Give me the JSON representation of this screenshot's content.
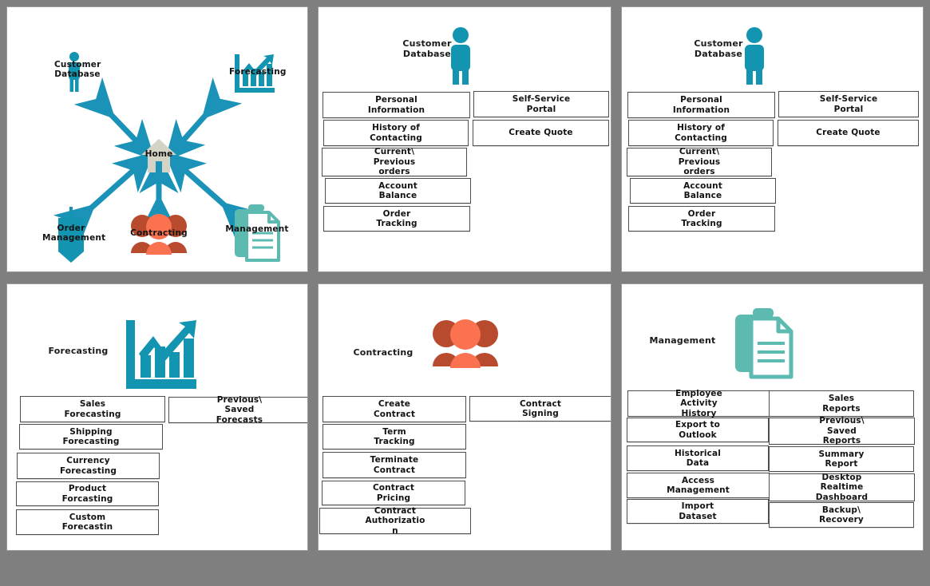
{
  "document": {
    "kind": "wireframe-storyboard",
    "rows": 2,
    "columns": 3,
    "background_color": "#7f7f7f",
    "panel_background": "#ffffff"
  },
  "colors": {
    "teal_blue": "#1394b0",
    "teal_green": "#5dbab0",
    "orange_front": "#fa7250",
    "orange_back": "#b84a2e",
    "home_gray": "#d5d2c6",
    "arrow_blue": "#1b93b8",
    "box_border": "#4d4d4d",
    "text": "#131313",
    "frame_gray": "#7f7f7f"
  },
  "panels": [
    {
      "id": "navigation-map",
      "type": "map",
      "center_node": {
        "label": "Home",
        "icon": "home-icon"
      },
      "nodes": [
        {
          "label": "Customer\nDatabase",
          "label_line1": "Customer",
          "label_line2": "Database",
          "icon": "person-icon",
          "position": "top-left"
        },
        {
          "label": "Forecasting",
          "label_line1": "Forecasting",
          "label_line2": "",
          "icon": "bar-chart-arrow-icon",
          "position": "top-right"
        },
        {
          "label": "Order\nManagement",
          "label_line1": "Order",
          "label_line2": "Management",
          "icon": "tag-icon",
          "position": "bottom-left"
        },
        {
          "label": "Contracting",
          "label_line1": "Contracting",
          "label_line2": "",
          "icon": "people-group-icon",
          "position": "bottom-center"
        },
        {
          "label": "Management",
          "label_line1": "Management",
          "label_line2": "",
          "icon": "clipboard-document-icon",
          "position": "bottom-right"
        }
      ],
      "connectors": [
        {
          "from": "Home",
          "to": "Customer Database",
          "style": "double-arrow"
        },
        {
          "from": "Home",
          "to": "Forecasting",
          "style": "double-arrow"
        },
        {
          "from": "Home",
          "to": "Order Management",
          "style": "double-arrow"
        },
        {
          "from": "Home",
          "to": "Contracting",
          "style": "double-arrow"
        },
        {
          "from": "Home",
          "to": "Management",
          "style": "double-arrow"
        }
      ]
    },
    {
      "id": "customer-database-a",
      "type": "screen",
      "title_line1": "Customer",
      "title_line2": "Database",
      "icon": "person-icon",
      "left_items": [
        {
          "line1": "Personal",
          "line2": "Information",
          "line3": ""
        },
        {
          "line1": "History of",
          "line2": "Contacting",
          "line3": ""
        },
        {
          "line1": "Current\\",
          "line2": "Previous",
          "line3": "orders"
        },
        {
          "line1": "Account",
          "line2": "Balance",
          "line3": ""
        },
        {
          "line1": "Order",
          "line2": "Tracking",
          "line3": ""
        }
      ],
      "right_items": [
        {
          "line1": "Self-Service",
          "line2": "Portal",
          "line3": ""
        },
        {
          "line1": "Create Quote",
          "line2": "",
          "line3": ""
        }
      ]
    },
    {
      "id": "customer-database-b",
      "type": "screen",
      "title_line1": "Customer",
      "title_line2": "Database",
      "icon": "person-icon",
      "left_items": [
        {
          "line1": "Personal",
          "line2": "Information",
          "line3": ""
        },
        {
          "line1": "History of",
          "line2": "Contacting",
          "line3": ""
        },
        {
          "line1": "Current\\",
          "line2": "Previous",
          "line3": "orders"
        },
        {
          "line1": "Account",
          "line2": "Balance",
          "line3": ""
        },
        {
          "line1": "Order",
          "line2": "Tracking",
          "line3": ""
        }
      ],
      "right_items": [
        {
          "line1": "Self-Service",
          "line2": "Portal",
          "line3": ""
        },
        {
          "line1": "Create Quote",
          "line2": "",
          "line3": ""
        }
      ]
    },
    {
      "id": "forecasting",
      "type": "screen",
      "title_line1": "Forecasting",
      "title_line2": "",
      "icon": "bar-chart-arrow-icon",
      "left_items": [
        {
          "line1": "Sales",
          "line2": "Forecasting",
          "line3": ""
        },
        {
          "line1": "Shipping",
          "line2": "Forecasting",
          "line3": ""
        },
        {
          "line1": "Currency",
          "line2": "Forecasting",
          "line3": ""
        },
        {
          "line1": "Product",
          "line2": "Forcasting",
          "line3": ""
        },
        {
          "line1": "Custom",
          "line2": "Forecastin",
          "line3": ""
        }
      ],
      "right_items": [
        {
          "line1": "Previous\\",
          "line2": "Saved",
          "line3": "Forecasts"
        }
      ]
    },
    {
      "id": "contracting",
      "type": "screen",
      "title_line1": "Contracting",
      "title_line2": "",
      "icon": "people-group-icon",
      "left_items": [
        {
          "line1": "Create",
          "line2": "Contract",
          "line3": ""
        },
        {
          "line1": "Term",
          "line2": "Tracking",
          "line3": ""
        },
        {
          "line1": "Terminate",
          "line2": "Contract",
          "line3": ""
        },
        {
          "line1": "Contract",
          "line2": "Pricing",
          "line3": ""
        },
        {
          "line1": "Contract",
          "line2": "Authorizatio",
          "line3": "n"
        }
      ],
      "right_items": [
        {
          "line1": "Contract",
          "line2": "Signing",
          "line3": ""
        }
      ]
    },
    {
      "id": "management",
      "type": "screen",
      "title_line1": "Management",
      "title_line2": "",
      "icon": "clipboard-document-icon",
      "left_items": [
        {
          "line1": "Employee",
          "line2": "Activity",
          "line3": "History"
        },
        {
          "line1": "Export to",
          "line2": "Outlook",
          "line3": ""
        },
        {
          "line1": "Historical",
          "line2": "Data",
          "line3": ""
        },
        {
          "line1": "Access",
          "line2": "Management",
          "line3": ""
        },
        {
          "line1": "Import",
          "line2": "Dataset",
          "line3": ""
        }
      ],
      "right_items": [
        {
          "line1": "Sales",
          "line2": "Reports",
          "line3": ""
        },
        {
          "line1": "Previous\\",
          "line2": "Saved",
          "line3": "Reports"
        },
        {
          "line1": "Summary",
          "line2": "Report",
          "line3": ""
        },
        {
          "line1": "Desktop",
          "line2": "Realtime",
          "line3": "Dashboard"
        },
        {
          "line1": "Backup\\",
          "line2": "Recovery",
          "line3": ""
        }
      ]
    }
  ]
}
